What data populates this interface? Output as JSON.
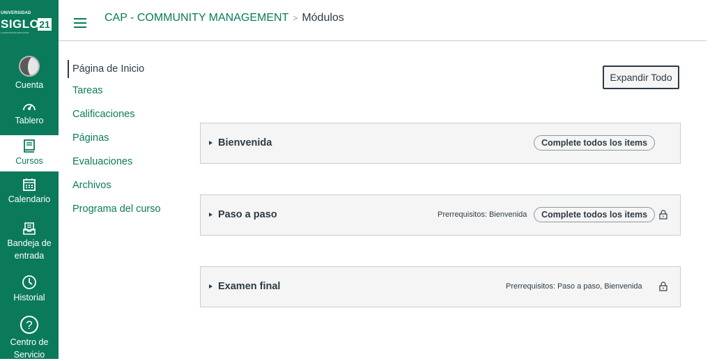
{
  "logo": {
    "line1": "UNIVERSIDAD",
    "line2": "SIGLO",
    "num": "21",
    "line3": "LA INNOVACIÓN EDUCATIVA"
  },
  "global_nav": [
    {
      "label": "Cuenta",
      "icon": "avatar-icon"
    },
    {
      "label": "Tablero",
      "icon": "dashboard-icon"
    },
    {
      "label": "Cursos",
      "icon": "courses-icon",
      "active": true
    },
    {
      "label": "Calendario",
      "icon": "calendar-icon"
    },
    {
      "label1": "Bandeja de",
      "label2": "entrada",
      "icon": "inbox-icon"
    },
    {
      "label": "Historial",
      "icon": "history-icon"
    },
    {
      "label1": "Centro de",
      "label2": "Servicio",
      "icon": "help-icon"
    }
  ],
  "breadcrumb": {
    "course": "CAP - COMMUNITY MANAGEMENT",
    "separator": ">",
    "page": "Módulos"
  },
  "course_nav": [
    "Página de Inicio",
    "Tareas",
    "Calificaciones",
    "Páginas",
    "Evaluaciones",
    "Archivos",
    "Programa del curso"
  ],
  "expand_all": "Expandir Todo",
  "modules": [
    {
      "title": "Bienvenida",
      "prereq": "",
      "requirement": "Complete todos los items",
      "locked": false
    },
    {
      "title": "Paso a paso",
      "prereq": "Prerrequisitos: Bienvenida",
      "requirement": "Complete todos los items",
      "locked": true
    },
    {
      "title": "Examen final",
      "prereq": "Prerrequisitos: Paso a paso, Bienvenida",
      "requirement": "",
      "locked": true
    }
  ],
  "colors": {
    "brand": "#0a7a5b",
    "text": "#2d3b45",
    "module_bg": "#f5f5f5"
  }
}
